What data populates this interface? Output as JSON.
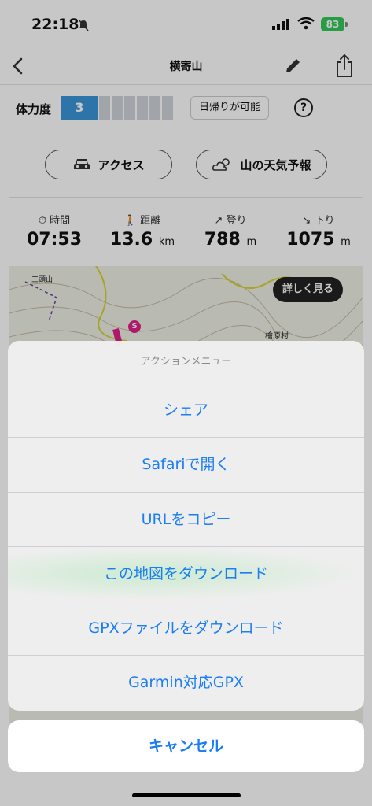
{
  "status": {
    "time": "22:18",
    "battery": "83"
  },
  "nav": {
    "title": "横寄山"
  },
  "stamina": {
    "label": "体力度",
    "level": "3",
    "note": "日帰りが可能",
    "help": "?"
  },
  "buttons": {
    "access": "アクセス",
    "weather": "山の天気予報"
  },
  "stats": [
    {
      "label": "時間",
      "value": "07:53",
      "unit": ""
    },
    {
      "label": "距離",
      "value": "13.6",
      "unit": "km"
    },
    {
      "label": "登り",
      "value": "788",
      "unit": "m"
    },
    {
      "label": "下り",
      "value": "1075",
      "unit": "m"
    }
  ],
  "map": {
    "detail_button": "詳しく見る",
    "place_labels": [
      "三頭山",
      "檜原村"
    ],
    "start_marker": "S"
  },
  "action_sheet": {
    "title": "アクションメニュー",
    "items": [
      "シェア",
      "Safariで開く",
      "URLをコピー",
      "この地図をダウンロード",
      "GPXファイルをダウンロード",
      "Garmin対応GPX"
    ],
    "cancel": "キャンセル"
  },
  "colors": {
    "accent": "#1b7ef2",
    "stamina": "#3a95d8",
    "battery": "#34c759",
    "route": "#e0218a"
  }
}
